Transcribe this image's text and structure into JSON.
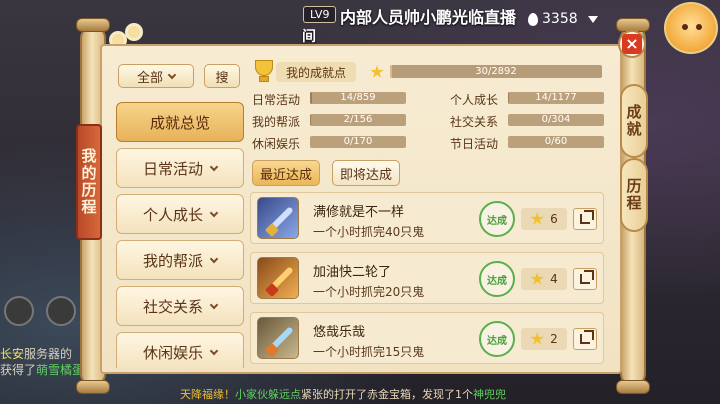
{
  "stream": {
    "level": "LV9",
    "title_line1": "内部人员帅小鹏光临直播",
    "title_line2": "间",
    "viewers": "3358"
  },
  "chat": {
    "line1_prefix": "长安",
    "line1_rest": "服务器的",
    "line2_prefix": "获得了",
    "line2_hl": "萌雪橘蛋"
  },
  "ticker": {
    "prefix": "天降福缘！",
    "actor": "小家伙躲远点",
    "mid": "紧张的打开了赤金宝箱，发现了1个",
    "item": "神兜兜"
  },
  "panel": {
    "left_ribbon": "我的历程",
    "right_tabs": [
      "成就",
      "历程"
    ],
    "close_label": "×"
  },
  "filter": {
    "selected": "全部",
    "search_label": "搜"
  },
  "categories": [
    {
      "label": "成就总览",
      "active": true
    },
    {
      "label": "日常活动",
      "active": false
    },
    {
      "label": "个人成长",
      "active": false
    },
    {
      "label": "我的帮派",
      "active": false
    },
    {
      "label": "社交关系",
      "active": false
    },
    {
      "label": "休闲娱乐",
      "active": false
    }
  ],
  "summary": {
    "my_points_label": "我的成就点",
    "points_text": "30/2892",
    "points_fraction": 0.0104
  },
  "stats": [
    {
      "label": "日常活动",
      "text": "14/859",
      "fraction": 0.016
    },
    {
      "label": "个人成长",
      "text": "14/1177",
      "fraction": 0.012
    },
    {
      "label": "我的帮派",
      "text": "2/156",
      "fraction": 0.013
    },
    {
      "label": "社交关系",
      "text": "0/304",
      "fraction": 0
    },
    {
      "label": "休闲娱乐",
      "text": "0/170",
      "fraction": 0
    },
    {
      "label": "节日活动",
      "text": "0/60",
      "fraction": 0
    }
  ],
  "tabs": {
    "recent": "最近达成",
    "upcoming": "即将达成"
  },
  "achievements": [
    {
      "name": "满修就是不一样",
      "desc": "一个小时抓完40只鬼",
      "stamp": "达成",
      "points": "6",
      "icon": "blue-sword-icon"
    },
    {
      "name": "加油快二轮了",
      "desc": "一个小时抓完20只鬼",
      "stamp": "达成",
      "points": "4",
      "icon": "gold-sword-icon"
    },
    {
      "name": "悠哉乐哉",
      "desc": "一个小时抓完15只鬼",
      "stamp": "达成",
      "points": "2",
      "icon": "azure-sword-icon"
    }
  ],
  "colors": {
    "stamp_green": "#48a03a",
    "active_tab": "#ebb758",
    "ribbon_red": "#b84a2a"
  }
}
